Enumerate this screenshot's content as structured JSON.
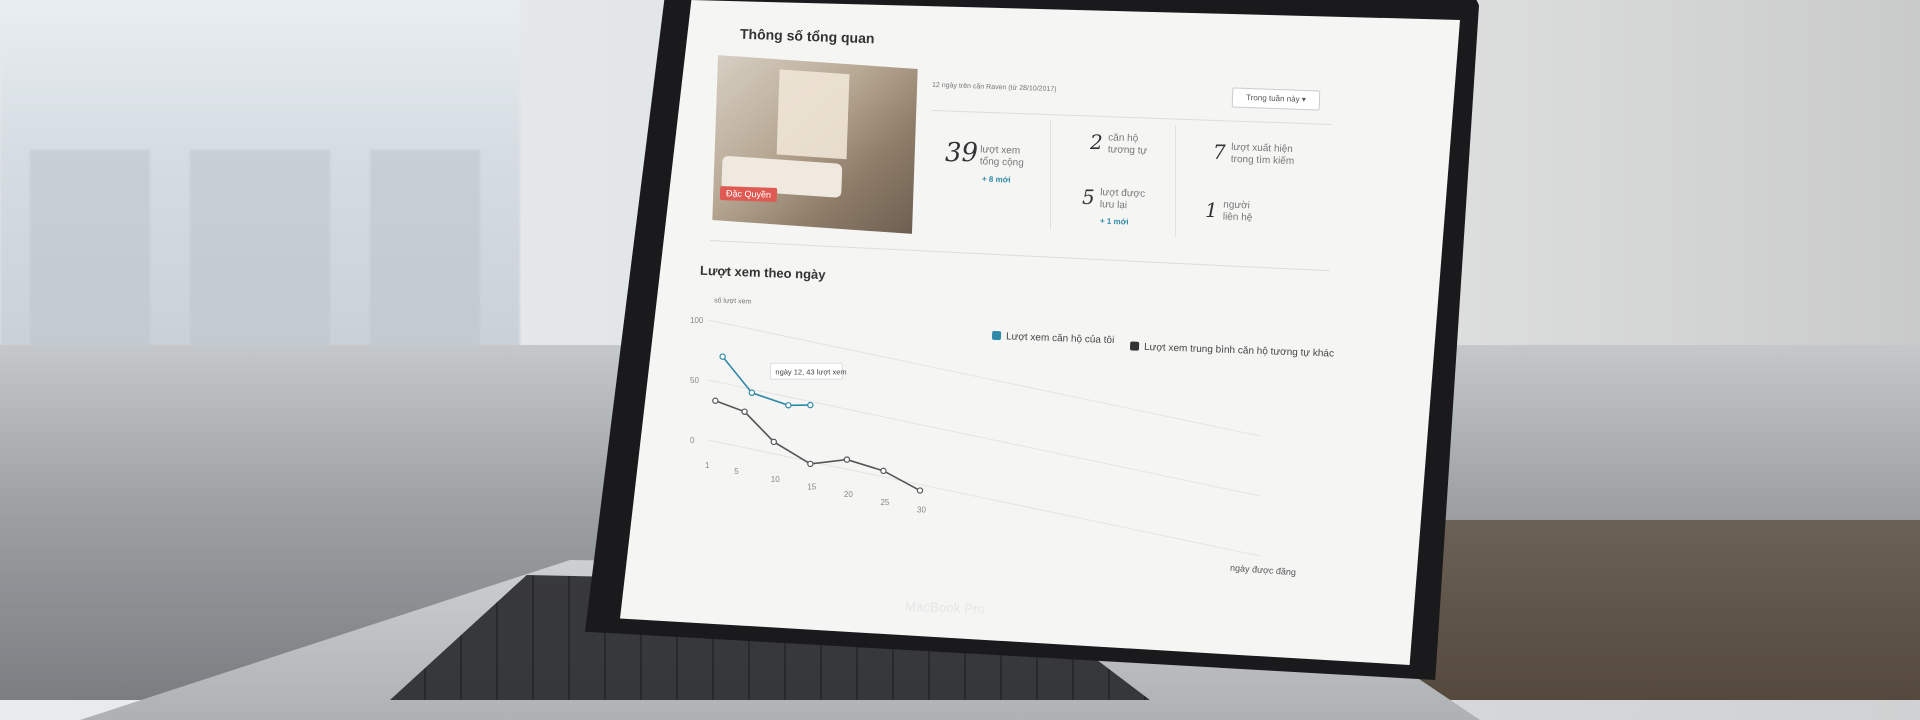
{
  "scene": {
    "brand": "MacBook Pro"
  },
  "overview": {
    "title": "Thông số tổng quan",
    "photo_badge": "Đặc Quyền",
    "since_note": "12 ngày trên căn Raven (từ 28/10/2017)",
    "period_dropdown": "Trong tuần này",
    "stats": [
      {
        "num": "39",
        "label": "lượt xem\ntổng cộng",
        "delta": "+ 8 mới"
      },
      {
        "num": "2",
        "label": "căn hộ\ntương tự",
        "delta": ""
      },
      {
        "num": "7",
        "label": "lượt xuất hiện\ntrong tìm kiếm",
        "delta": ""
      },
      {
        "num": "5",
        "label": "lượt được\nlưu lại",
        "delta": "+ 1 mới"
      },
      {
        "num": "1",
        "label": "người\nliên hệ",
        "delta": ""
      }
    ]
  },
  "chart_section": {
    "title": "Lượt xem theo ngày",
    "ylabel": "số lượt xem",
    "xlabel": "ngày được đăng",
    "legend": [
      {
        "label": "Lượt xem căn hộ của tôi",
        "color": "#2e8aa8"
      },
      {
        "label": "Lượt xem trung bình căn hộ tương tự khác",
        "color": "#333333"
      }
    ],
    "tooltip": "ngày 12, 43 lượt xem"
  },
  "chart_data": {
    "type": "line",
    "xlabel": "ngày được đăng",
    "ylabel": "số lượt xem",
    "ylim": [
      0,
      100
    ],
    "yticks": [
      0,
      50,
      100
    ],
    "xticks": [
      1,
      5,
      10,
      15,
      20,
      25,
      30
    ],
    "series": [
      {
        "name": "Lượt xem căn hộ của tôi",
        "color": "#2e8aa8",
        "x": [
          3,
          7,
          12,
          15
        ],
        "y": [
          72,
          47,
          43,
          47
        ]
      },
      {
        "name": "Lượt xem trung bình căn hộ tương tự khác",
        "color": "#555555",
        "x": [
          2,
          6,
          10,
          15,
          20,
          25,
          30
        ],
        "y": [
          34,
          30,
          10,
          -2,
          8,
          5,
          -5
        ]
      }
    ]
  }
}
